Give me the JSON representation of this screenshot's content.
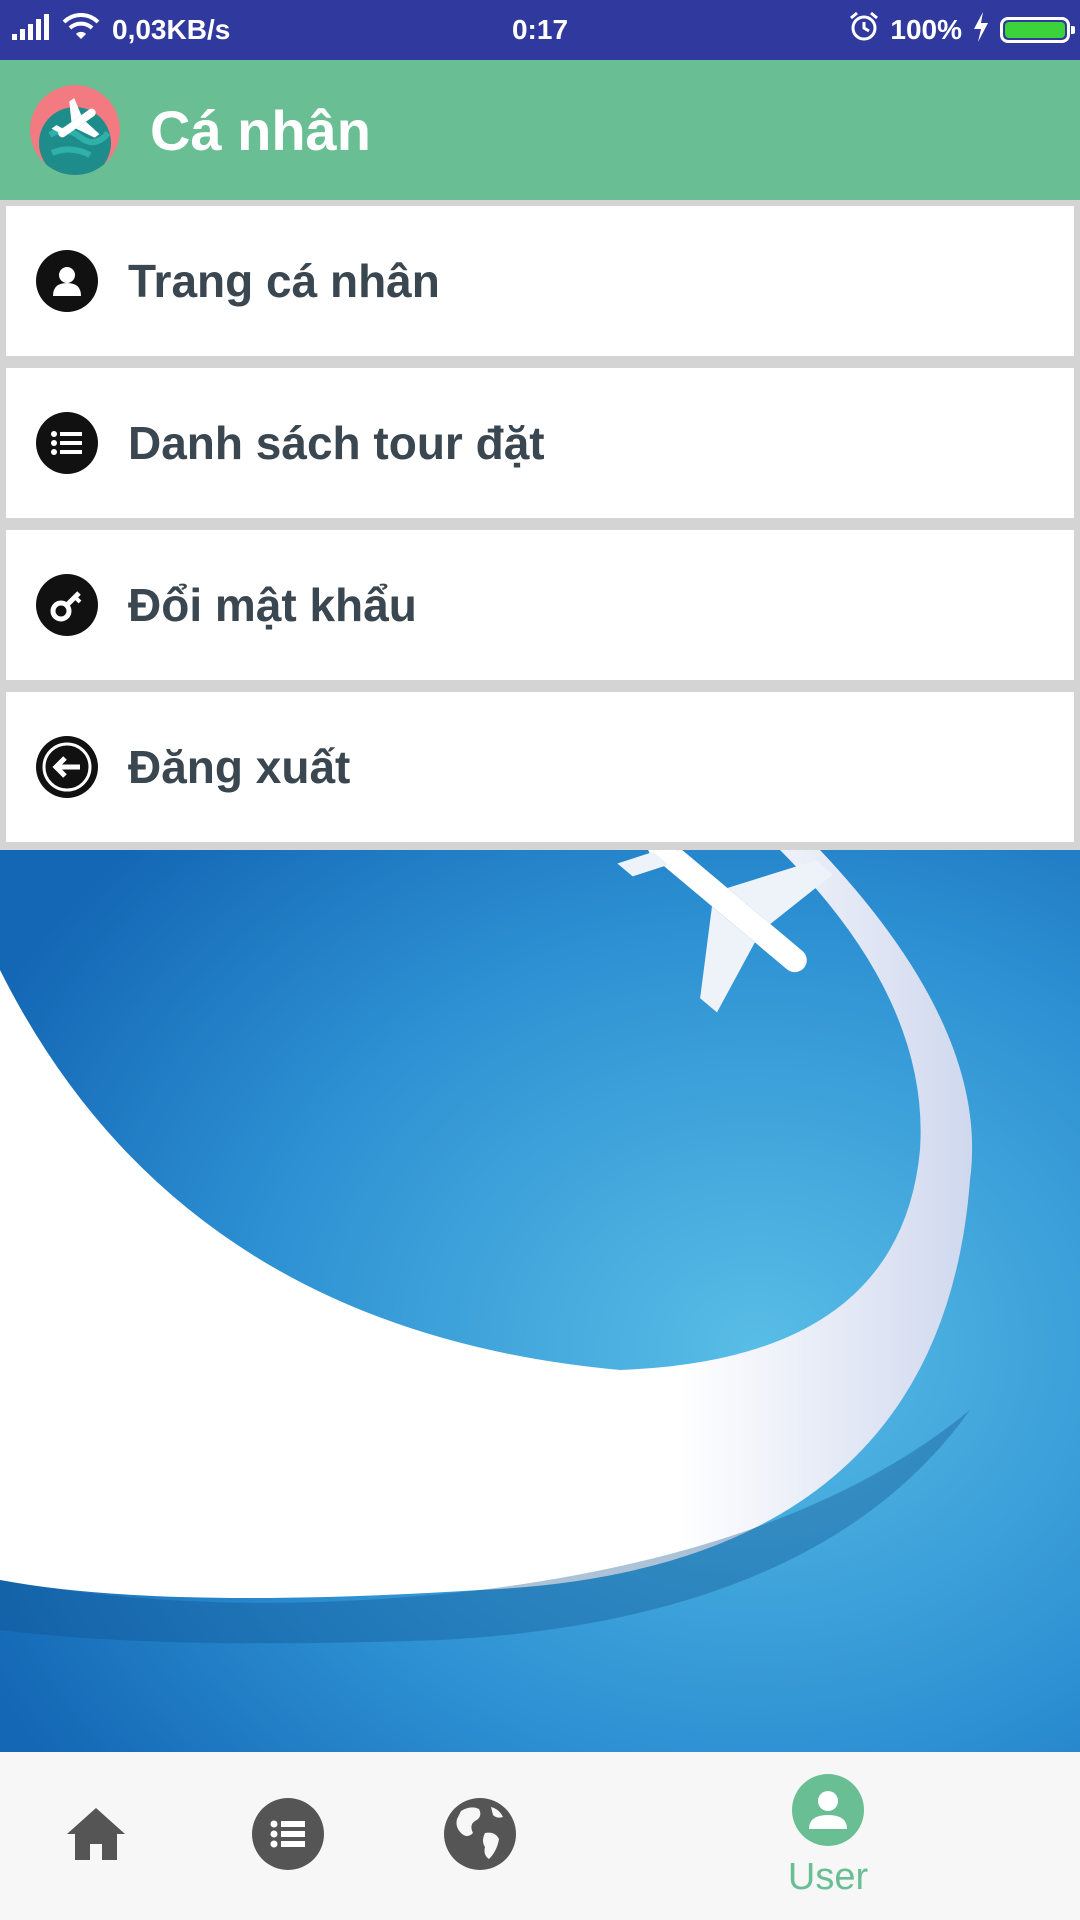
{
  "status_bar": {
    "network_speed": "0,03KB/s",
    "time": "0:17",
    "battery_percent": "100%",
    "battery_level": 1.0
  },
  "header": {
    "title": "Cá nhân",
    "logo_icon": "globe-plane-logo"
  },
  "menu": {
    "items": [
      {
        "label": "Trang cá nhân",
        "icon": "person-icon"
      },
      {
        "label": "Danh sách tour đặt",
        "icon": "list-icon"
      },
      {
        "label": "Đổi mật khẩu",
        "icon": "key-icon"
      },
      {
        "label": "Đăng xuất",
        "icon": "logout-icon"
      }
    ]
  },
  "bottom_nav": {
    "items": [
      {
        "icon": "home-icon",
        "label": ""
      },
      {
        "icon": "list-icon",
        "label": ""
      },
      {
        "icon": "globe-icon",
        "label": ""
      },
      {
        "icon": "user-icon",
        "label": "User",
        "active": true
      }
    ]
  },
  "colors": {
    "status_bar": "#303a9e",
    "app_bar": "#69bf93",
    "accent": "#69bf93",
    "menu_text": "#3a4650",
    "nav_icon": "#555555"
  }
}
